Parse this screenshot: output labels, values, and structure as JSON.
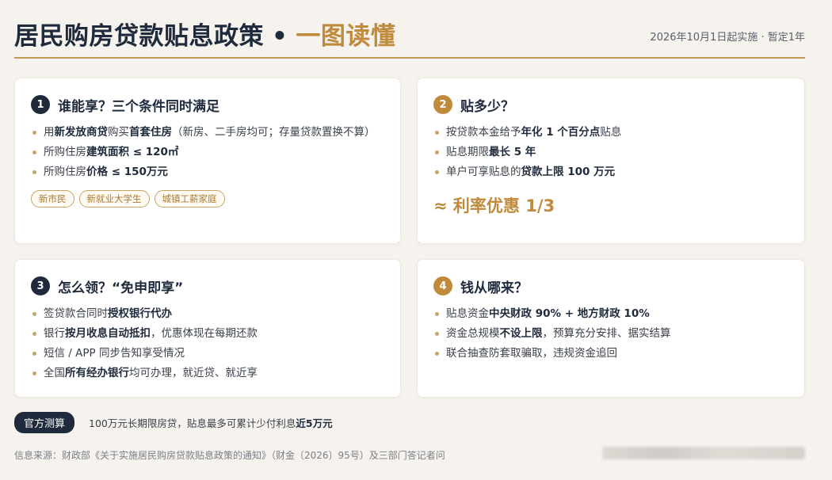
{
  "header": {
    "title_main": "居民购房贷款贴息政策",
    "title_dot": "•",
    "title_accent": "一图读懂",
    "meta": "2026年10月1日起实施 · 暂定1年"
  },
  "colors": {
    "navy": "#1f2a3c",
    "gold": "#c08a3c",
    "background": "#f6f3ee"
  },
  "cards": [
    {
      "num": "1",
      "title": "谁能享？三个条件同时满足",
      "items": [
        [
          [
            "用",
            ""
          ],
          [
            "新发放商贷",
            "b"
          ],
          [
            "购买",
            ""
          ],
          [
            "首套住房",
            "b"
          ],
          [
            "（新房、二手房均可；存量贷款置换不算）",
            ""
          ]
        ],
        [
          [
            "所购住房",
            ""
          ],
          [
            "建筑面积 ≤ 120㎡",
            "b"
          ]
        ],
        [
          [
            "所购住房",
            ""
          ],
          [
            "价格 ≤ 150万元",
            "b"
          ]
        ]
      ],
      "tags": [
        "新市民",
        "新就业大学生",
        "城镇工薪家庭"
      ]
    },
    {
      "num": "2",
      "title": "贴多少？",
      "items": [
        [
          [
            "按贷款本金给予",
            ""
          ],
          [
            "年化 1 个百分点",
            "b"
          ],
          [
            "贴息",
            ""
          ]
        ],
        [
          [
            "贴息期限",
            ""
          ],
          [
            "最长 5 年",
            "b"
          ]
        ],
        [
          [
            "单户可享贴息的",
            ""
          ],
          [
            "贷款上限 100 万元",
            "b"
          ]
        ]
      ],
      "highlight": "≈ 利率优惠 1/3"
    },
    {
      "num": "3",
      "title": "怎么领？“免申即享”",
      "items": [
        [
          [
            "签贷款合同时",
            ""
          ],
          [
            "授权银行代办",
            "b"
          ]
        ],
        [
          [
            "银行",
            ""
          ],
          [
            "按月收息自动抵扣",
            "b"
          ],
          [
            "，优惠体现在每期还款",
            ""
          ]
        ],
        [
          [
            "短信 / APP 同步告知享受情况",
            ""
          ]
        ],
        [
          [
            "全国",
            ""
          ],
          [
            "所有经办银行",
            "b"
          ],
          [
            "均可办理，就近贷、就近享",
            ""
          ]
        ]
      ]
    },
    {
      "num": "4",
      "title": "钱从哪来？",
      "items": [
        [
          [
            "贴息资金",
            ""
          ],
          [
            "中央财政 90% + 地方财政 10%",
            "b"
          ]
        ],
        [
          [
            "资金总规模",
            ""
          ],
          [
            "不设上限",
            "b"
          ],
          [
            "，预算充分安排、据实结算",
            ""
          ]
        ],
        [
          [
            "联合抽查防套取骗取，违规资金追回",
            ""
          ]
        ]
      ]
    }
  ],
  "bottom": {
    "badge": "官方测算",
    "calc_pre": "100万元长期限房贷，贴息最多可累计少付利息",
    "calc_bold": "近5万元"
  },
  "source": "信息来源：财政部《关于实施居民购房贷款贴息政策的通知》（财金〔2026〕95号）及三部门答记者问"
}
